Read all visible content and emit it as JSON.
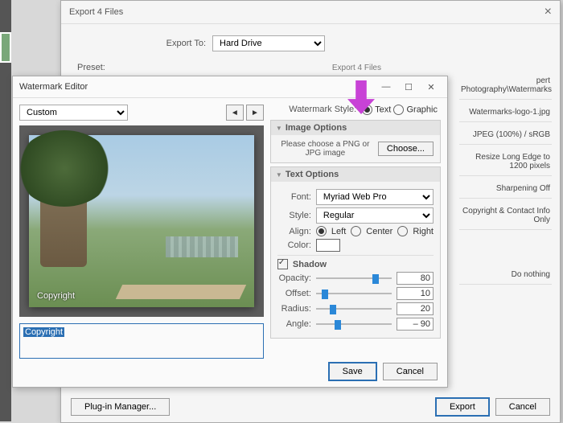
{
  "bg": {
    "title": "Export 4 Files",
    "exportToLabel": "Export To:",
    "exportToValue": "Hard Drive",
    "presetLabel": "Preset:",
    "sectionLabel": "Export 4 Files",
    "rightInfo": {
      "path": "pert Photography\\Watermarks",
      "file": "Watermarks-logo-1.jpg",
      "format": "JPEG (100%) / sRGB",
      "resize": "Resize Long Edge to 1200 pixels",
      "sharpen": "Sharpening Off",
      "meta": "Copyright & Contact Info Only",
      "post": "Do nothing"
    },
    "plugMgr": "Plug-in Manager...",
    "export": "Export",
    "cancel": "Cancel"
  },
  "wm": {
    "title": "Watermark Editor",
    "presetValue": "Custom",
    "styleLabel": "Watermark Style:",
    "styleText": "Text",
    "styleGraphic": "Graphic",
    "imageOptions": {
      "header": "Image Options",
      "hint": "Please choose a PNG or JPG image",
      "choose": "Choose..."
    },
    "textOptions": {
      "header": "Text Options",
      "fontLabel": "Font:",
      "fontValue": "Myriad Web Pro",
      "styleLabel": "Style:",
      "styleValue": "Regular",
      "alignLabel": "Align:",
      "alignLeft": "Left",
      "alignCenter": "Center",
      "alignRight": "Right",
      "colorLabel": "Color:"
    },
    "shadow": {
      "label": "Shadow",
      "opacityLabel": "Opacity:",
      "opacity": "80",
      "offsetLabel": "Offset:",
      "offset": "10",
      "radiusLabel": "Radius:",
      "radius": "20",
      "angleLabel": "Angle:",
      "angle": "– 90"
    },
    "previewText": "Copyright",
    "inputText": "Copyright",
    "save": "Save",
    "cancel": "Cancel"
  }
}
